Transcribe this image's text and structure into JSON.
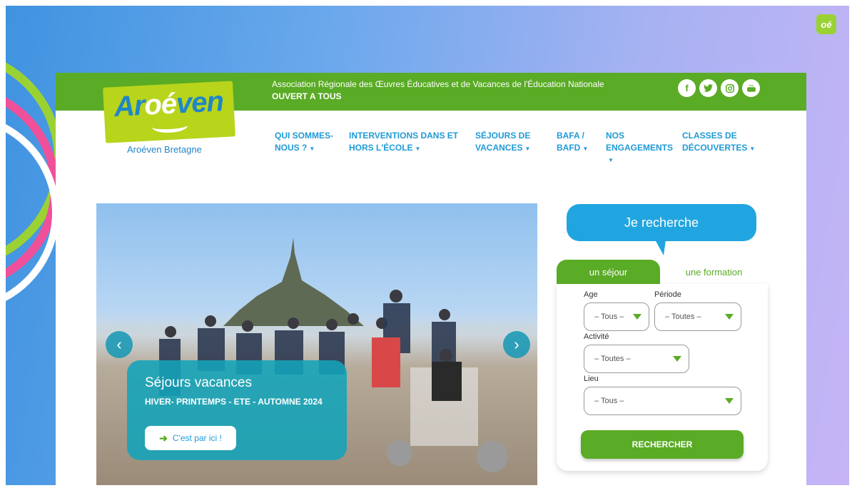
{
  "brand": {
    "logo_prefix": "Ar",
    "logo_o": "oé",
    "logo_suffix": "ven",
    "subtitle": "Aroéven Bretagne",
    "corner_badge": "oé",
    "colors": {
      "green": "#5aab25",
      "blue": "#1f9ad6",
      "lime": "#b8d41b"
    }
  },
  "topbar": {
    "association": "Association Régionale des Œuvres Éducatives et de Vacances de l'Éducation Nationale",
    "open": "OUVERT A TOUS",
    "socials": [
      {
        "icon": "facebook-icon",
        "glyph": "f"
      },
      {
        "icon": "twitter-icon",
        "glyph": "🐦"
      },
      {
        "icon": "instagram-icon",
        "glyph": "◎"
      },
      {
        "icon": "youtube-icon",
        "glyph": "▶"
      }
    ]
  },
  "nav": [
    {
      "line1": "QUI SOMMES-",
      "line2": "NOUS ?"
    },
    {
      "line1": "INTERVENTIONS DANS ET",
      "line2": "HORS L'ÉCOLE"
    },
    {
      "line1": "SÉJOURS DE",
      "line2": "VACANCES"
    },
    {
      "line1": "BAFA /",
      "line2": "BAFD"
    },
    {
      "line1": "NOS",
      "line2": "ENGAGEMENTS"
    },
    {
      "line1": "CLASSES DE",
      "line2": "DÉCOUVERTES"
    }
  ],
  "hero": {
    "title": "Séjours vacances",
    "subtitle": "HIVER- PRINTEMPS - ETE - AUTOMNE 2024",
    "cta": "C'est par ici !",
    "prev": "‹",
    "next": "›"
  },
  "search": {
    "heading": "Je recherche",
    "tab_active": "un séjour",
    "tab_other": "une formation",
    "age_label": "Age",
    "age_value": "– Tous –",
    "periode_label": "Période",
    "periode_value": "– Toutes –",
    "activite_label": "Activité",
    "activite_value": "– Toutes –",
    "lieu_label": "Lieu",
    "lieu_value": "– Tous –",
    "button": "RECHERCHER"
  }
}
